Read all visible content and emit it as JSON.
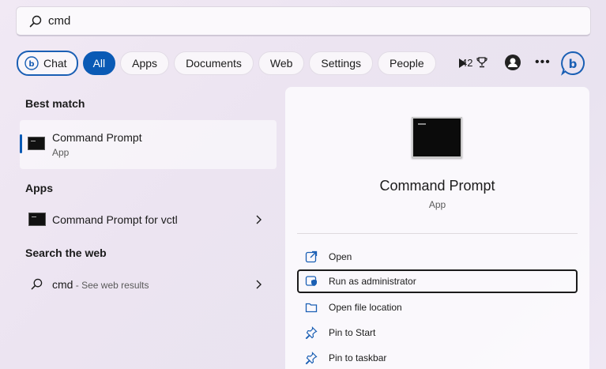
{
  "search": {
    "value": "cmd"
  },
  "filters": {
    "chat": "Chat",
    "all": "All",
    "apps": "Apps",
    "documents": "Documents",
    "web": "Web",
    "settings": "Settings",
    "people": "People"
  },
  "header": {
    "points": "42"
  },
  "left": {
    "best_match_title": "Best match",
    "best_match": {
      "title": "Command Prompt",
      "subtitle": "App"
    },
    "apps_title": "Apps",
    "apps_item": {
      "title": "Command Prompt for vctl"
    },
    "web_title": "Search the web",
    "web_item": {
      "query": "cmd",
      "suffix": " - See web results"
    }
  },
  "right": {
    "title": "Command Prompt",
    "subtitle": "App",
    "actions": [
      {
        "label": "Open",
        "icon": "open-icon"
      },
      {
        "label": "Run as administrator",
        "icon": "shield-icon"
      },
      {
        "label": "Open file location",
        "icon": "folder-icon"
      },
      {
        "label": "Pin to Start",
        "icon": "pin-icon"
      },
      {
        "label": "Pin to taskbar",
        "icon": "pin-icon"
      }
    ]
  },
  "colors": {
    "accent": "#0a5ab5"
  }
}
